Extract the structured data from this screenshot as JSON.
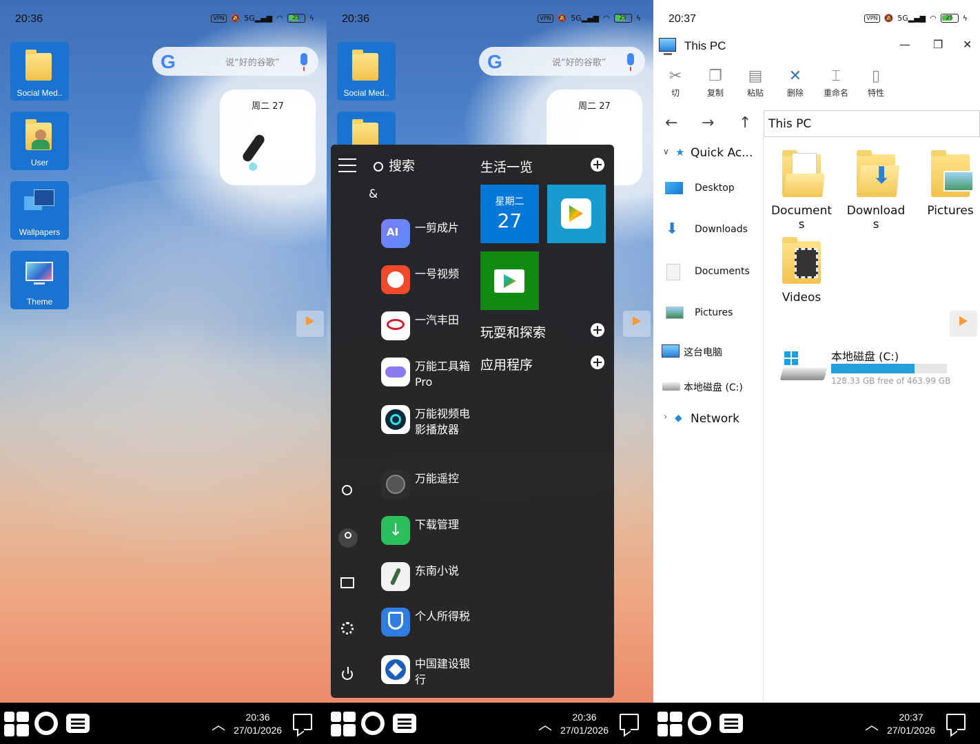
{
  "panel1": {
    "status": {
      "time": "20:36",
      "battery": "25"
    },
    "desktop_icons": [
      {
        "label": "Social Med.."
      },
      {
        "label": "User"
      },
      {
        "label": "Wallpapers"
      },
      {
        "label": "Theme"
      }
    ],
    "google_search": {
      "logo": "G",
      "placeholder": "说“好的谷歌”"
    },
    "date_widget": {
      "date": "周二 27"
    },
    "taskbar": {
      "time": "20:36",
      "date": "27/01/2026"
    }
  },
  "panel2": {
    "status": {
      "time": "20:36",
      "battery": "25"
    },
    "desktop_icons": [
      {
        "label": "Social Med.."
      }
    ],
    "google_search": {
      "logo": "G",
      "placeholder": "说“好的谷歌”"
    },
    "date_widget": {
      "date": "周二 27"
    },
    "start_menu": {
      "search_label": "搜索",
      "group_letter": "&",
      "apps": [
        {
          "name": "一剪成片",
          "color": "#6a6cf5"
        },
        {
          "name": "一号视频",
          "color": "#f04a2a"
        },
        {
          "name": "一汽丰田",
          "color": "#ffffff"
        },
        {
          "name": "万能工具箱Pro",
          "color": "#ffffff"
        },
        {
          "name": "万能视频电影播放器",
          "color": "#ffffff"
        },
        {
          "name": "万能遥控",
          "color": "#2d2d2d"
        },
        {
          "name": "下载管理",
          "color": "#2bbf5d"
        },
        {
          "name": "东南小说",
          "color": "#f2f2f2"
        },
        {
          "name": "个人所得税",
          "color": "#2f7de1"
        },
        {
          "name": "中国建设银行",
          "color": "#ffffff"
        }
      ],
      "sections": {
        "life": "生活一览",
        "play": "玩耍和探索",
        "apps": "应用程序"
      },
      "calendar_tile": {
        "weekday": "星期二",
        "day": "27"
      }
    },
    "taskbar": {
      "time": "20:36",
      "date": "27/01/2026"
    }
  },
  "panel3": {
    "status": {
      "time": "20:37",
      "battery": "25"
    },
    "window_title": "This PC",
    "ribbon": [
      {
        "label": "切",
        "icon": "scissors-icon"
      },
      {
        "label": "复制",
        "icon": "copy-icon"
      },
      {
        "label": "粘贴",
        "icon": "paste-icon"
      },
      {
        "label": "删除",
        "icon": "delete-icon"
      },
      {
        "label": "重命名",
        "icon": "rename-icon"
      },
      {
        "label": "特性",
        "icon": "properties-icon"
      }
    ],
    "address": "This PC",
    "sidebar": [
      {
        "label": "Quick Ac...",
        "icon": "star-icon"
      },
      {
        "label": "Desktop",
        "icon": "desktop-icon"
      },
      {
        "label": "Downloads",
        "icon": "download-icon"
      },
      {
        "label": "Documents",
        "icon": "document-icon"
      },
      {
        "label": "Pictures",
        "icon": "picture-icon"
      },
      {
        "label": "这台电脑",
        "icon": "computer-icon"
      },
      {
        "label": "本地磁盘 (C:)",
        "icon": "drive-icon"
      },
      {
        "label": "Network",
        "icon": "network-icon"
      }
    ],
    "folders": [
      {
        "label1": "Document",
        "label2": "s"
      },
      {
        "label1": "Download",
        "label2": "s"
      },
      {
        "label1": "Pictures",
        "label2": ""
      },
      {
        "label1": "Videos",
        "label2": ""
      }
    ],
    "drive": {
      "name": "本地磁盘 (C:)",
      "free_text": "128.33 GB free of 463.99 GB",
      "used_fraction": 0.72
    },
    "taskbar": {
      "time": "20:37",
      "date": "27/01/2026"
    }
  },
  "colors": {
    "tile_blue": "#0078d7",
    "tile_teal": "#1a9bd0",
    "tile_green": "#108a10",
    "drive_bar": "#26a0da"
  }
}
